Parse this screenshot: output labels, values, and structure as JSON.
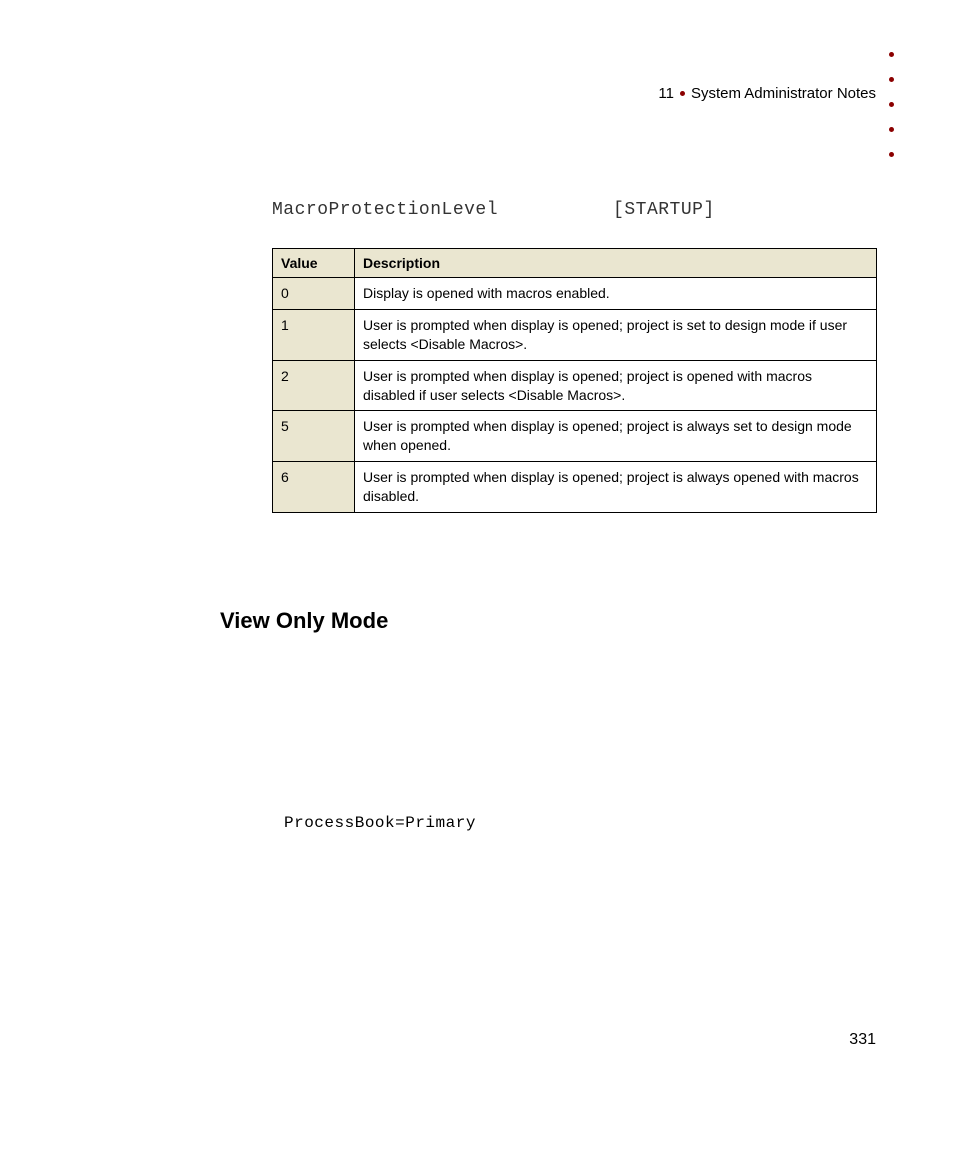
{
  "header": {
    "chapter_number": "11",
    "chapter_title": "System Administrator Notes"
  },
  "setting": {
    "name": "MacroProtectionLevel",
    "section": "[STARTUP]"
  },
  "table": {
    "headers": {
      "value": "Value",
      "description": "Description"
    },
    "rows": [
      {
        "value": "0",
        "description": "Display is opened with macros enabled."
      },
      {
        "value": "1",
        "description": "User is prompted when display is opened; project is set to design mode if user selects <Disable Macros>."
      },
      {
        "value": "2",
        "description": "User is prompted when display is opened; project is opened with macros disabled if user selects <Disable Macros>."
      },
      {
        "value": "5",
        "description": "User is prompted when display is opened; project is always set to design mode when opened."
      },
      {
        "value": "6",
        "description": "User is prompted when display is opened; project is always opened with macros disabled."
      }
    ]
  },
  "section_heading": "View Only Mode",
  "code_line": "ProcessBook=Primary",
  "page_number": "331"
}
